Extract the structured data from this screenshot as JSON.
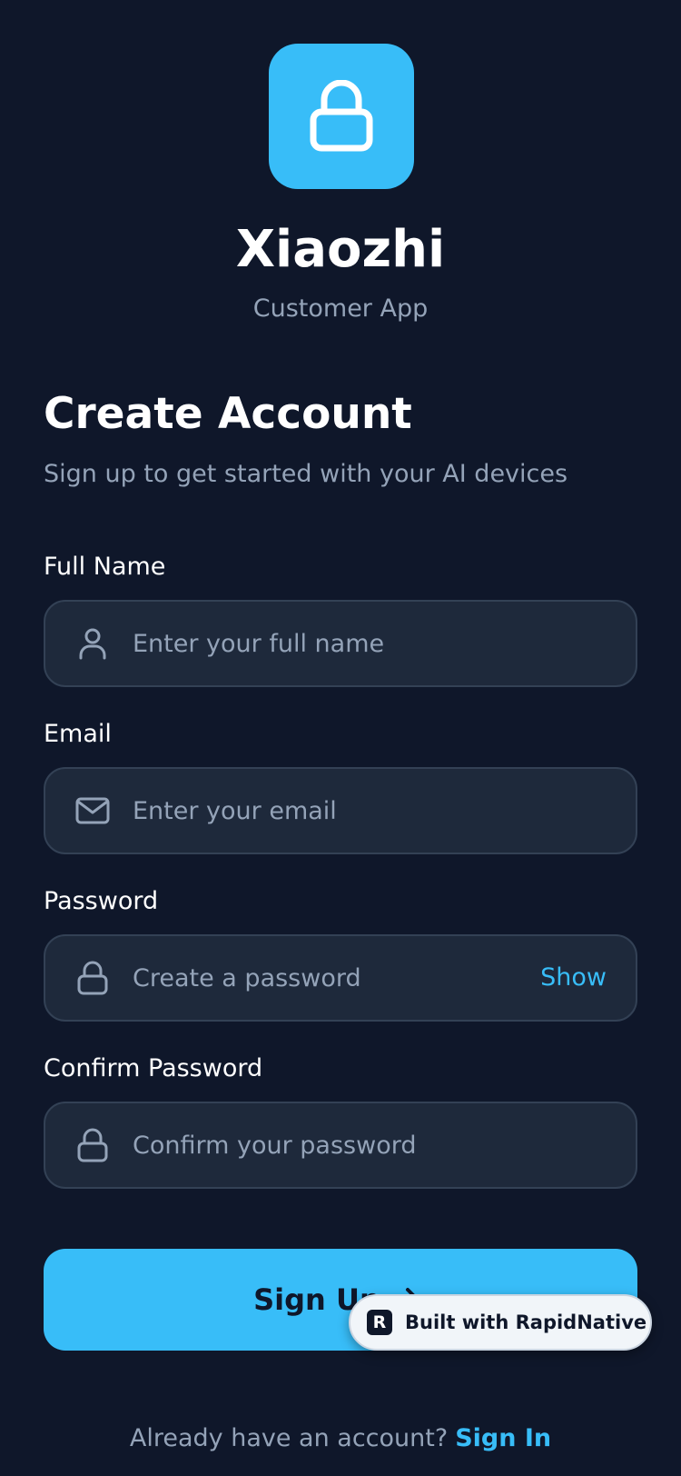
{
  "brand": {
    "app_name": "Xiaozhi",
    "app_subtitle": "Customer App",
    "logo_icon": "lock-icon",
    "accent_color": "#38bdf8",
    "background_color": "#0f172a"
  },
  "header": {
    "title": "Create Account",
    "subtitle": "Sign up to get started with your AI devices"
  },
  "form": {
    "full_name": {
      "label": "Full Name",
      "placeholder": "Enter your full name",
      "value": "",
      "icon": "user-icon"
    },
    "email": {
      "label": "Email",
      "placeholder": "Enter your email",
      "value": "",
      "icon": "mail-icon"
    },
    "password": {
      "label": "Password",
      "placeholder": "Create a password",
      "value": "",
      "icon": "lock-icon",
      "toggle_label": "Show"
    },
    "confirm_password": {
      "label": "Confirm Password",
      "placeholder": "Confirm your password",
      "value": "",
      "icon": "lock-icon"
    },
    "submit_label": "Sign Up",
    "submit_icon": "chevron-right-icon"
  },
  "badge": {
    "logo_letter": "R",
    "text": "Built with RapidNative"
  },
  "footer": {
    "prompt": "Already have an account?",
    "link_label": "Sign In"
  }
}
